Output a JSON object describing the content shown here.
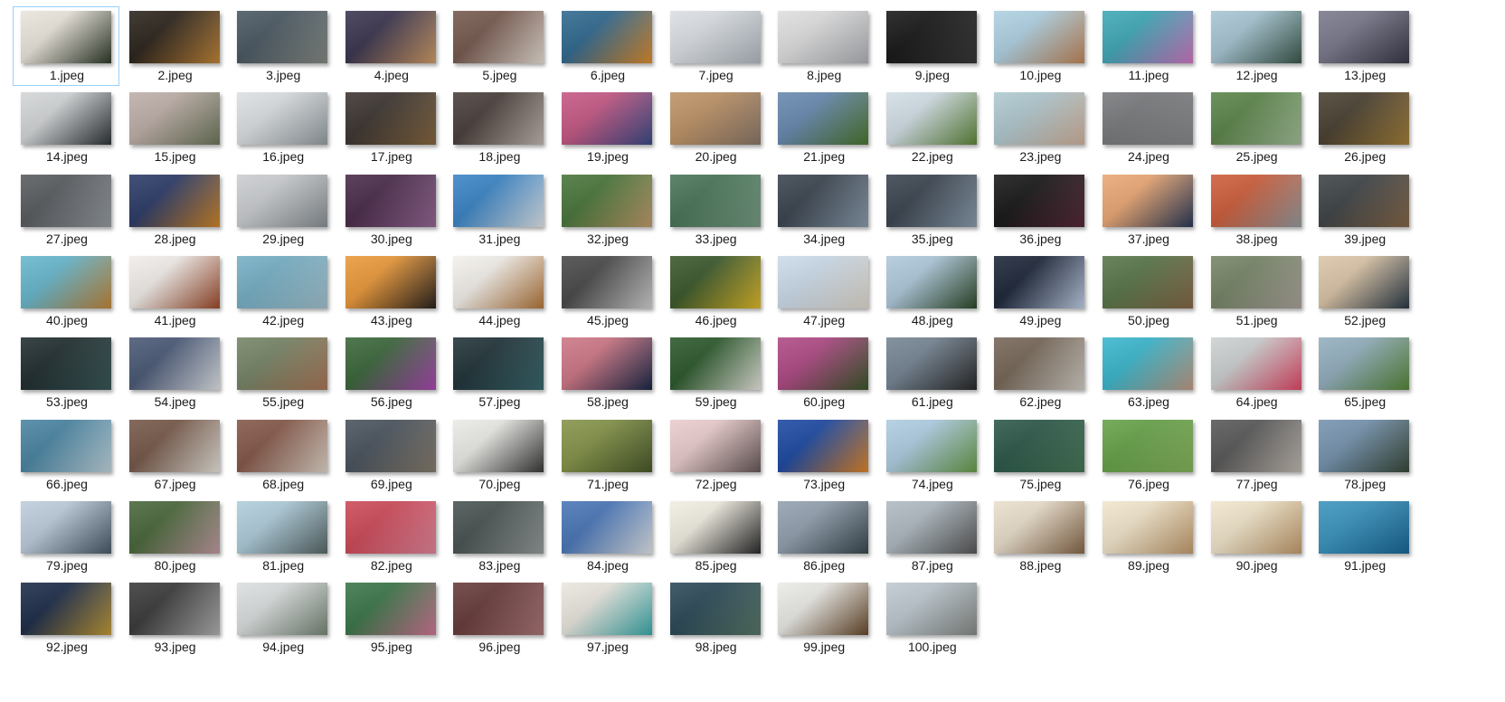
{
  "view": {
    "selected_index": 0,
    "columns": 13
  },
  "files": [
    {
      "name": "1.jpeg",
      "colors": [
        "#e8e2d8",
        "#2f3a2a"
      ]
    },
    {
      "name": "2.jpeg",
      "colors": [
        "#1a120a",
        "#c98a3a"
      ]
    },
    {
      "name": "3.jpeg",
      "colors": [
        "#3b4a55",
        "#8a8f88"
      ]
    },
    {
      "name": "4.jpeg",
      "colors": [
        "#2a2440",
        "#d8a26a"
      ]
    },
    {
      "name": "5.jpeg",
      "colors": [
        "#6a4b40",
        "#efe6dc"
      ]
    },
    {
      "name": "6.jpeg",
      "colors": [
        "#1f5c86",
        "#e8902c"
      ]
    },
    {
      "name": "7.jpeg",
      "colors": [
        "#d8dde2",
        "#b7bec6"
      ]
    },
    {
      "name": "8.jpeg",
      "colors": [
        "#dcdcdc",
        "#b5b8bd"
      ]
    },
    {
      "name": "9.jpeg",
      "colors": [
        "#050505",
        "#3a3a3a"
      ]
    },
    {
      "name": "10.jpeg",
      "colors": [
        "#a8cde0",
        "#c78a5a"
      ]
    },
    {
      "name": "11.jpeg",
      "colors": [
        "#2fa0b0",
        "#d77ac8"
      ]
    },
    {
      "name": "12.jpeg",
      "colors": [
        "#9fc0cf",
        "#3d5a4c"
      ]
    },
    {
      "name": "13.jpeg",
      "colors": [
        "#6e6e82",
        "#3a3a4a"
      ]
    },
    {
      "name": "14.jpeg",
      "colors": [
        "#cfd2d4",
        "#2e3438"
      ]
    },
    {
      "name": "15.jpeg",
      "colors": [
        "#b8a7a0",
        "#6f7a5e"
      ]
    },
    {
      "name": "16.jpeg",
      "colors": [
        "#d9dde0",
        "#9aa3a8"
      ]
    },
    {
      "name": "17.jpeg",
      "colors": [
        "#2c2420",
        "#8a6a42"
      ]
    },
    {
      "name": "18.jpeg",
      "colors": [
        "#3a2e2a",
        "#c9beb8"
      ]
    },
    {
      "name": "19.jpeg",
      "colors": [
        "#c04a7a",
        "#3b4e8a"
      ]
    },
    {
      "name": "20.jpeg",
      "colors": [
        "#b88a5a",
        "#8e7a6c"
      ]
    },
    {
      "name": "21.jpeg",
      "colors": [
        "#5b7fa8",
        "#4e7a2e"
      ]
    },
    {
      "name": "22.jpeg",
      "colors": [
        "#cfdbe4",
        "#5f8a3a"
      ]
    },
    {
      "name": "23.jpeg",
      "colors": [
        "#a9c4cc",
        "#d8b8a0"
      ]
    },
    {
      "name": "24.jpeg",
      "colors": [
        "#6d6f72",
        "#8c8e90"
      ]
    },
    {
      "name": "25.jpeg",
      "colors": [
        "#4e7a3a",
        "#a8c4a0"
      ]
    },
    {
      "name": "26.jpeg",
      "colors": [
        "#3a3020",
        "#a8823a"
      ]
    },
    {
      "name": "27.jpeg",
      "colors": [
        "#4a4e52",
        "#9aa0a6"
      ]
    },
    {
      "name": "28.jpeg",
      "colors": [
        "#1a2a5a",
        "#d88a2a"
      ]
    },
    {
      "name": "29.jpeg",
      "colors": [
        "#c6c9cc",
        "#8d9499"
      ]
    },
    {
      "name": "30.jpeg",
      "colors": [
        "#3a1a3a",
        "#9a6a9a"
      ]
    },
    {
      "name": "31.jpeg",
      "colors": [
        "#2a7ac0",
        "#e8eef2"
      ]
    },
    {
      "name": "32.jpeg",
      "colors": [
        "#3a6a2a",
        "#c8a070"
      ]
    },
    {
      "name": "33.jpeg",
      "colors": [
        "#3a6a4a",
        "#7aa088"
      ]
    },
    {
      "name": "34.jpeg",
      "colors": [
        "#2a3440",
        "#8fa2b4"
      ]
    },
    {
      "name": "35.jpeg",
      "colors": [
        "#2a3440",
        "#8fa2b4"
      ]
    },
    {
      "name": "36.jpeg",
      "colors": [
        "#050505",
        "#5a2a3a"
      ]
    },
    {
      "name": "37.jpeg",
      "colors": [
        "#e8a06a",
        "#2a3a5a"
      ]
    },
    {
      "name": "38.jpeg",
      "colors": [
        "#c8502a",
        "#9aa0a4"
      ]
    },
    {
      "name": "39.jpeg",
      "colors": [
        "#2e3438",
        "#8a6a4a"
      ]
    },
    {
      "name": "40.jpeg",
      "colors": [
        "#5ab0c8",
        "#c88a3a"
      ]
    },
    {
      "name": "41.jpeg",
      "colors": [
        "#f0ece8",
        "#a04a2a"
      ]
    },
    {
      "name": "42.jpeg",
      "colors": [
        "#6aa8c0",
        "#a8c8d4"
      ]
    },
    {
      "name": "43.jpeg",
      "colors": [
        "#e8902a",
        "#2a2420"
      ]
    },
    {
      "name": "44.jpeg",
      "colors": [
        "#f2efea",
        "#b8783a"
      ]
    },
    {
      "name": "45.jpeg",
      "colors": [
        "#3a3a3a",
        "#d8d8d8"
      ]
    },
    {
      "name": "46.jpeg",
      "colors": [
        "#2a4a1a",
        "#e8c02a"
      ]
    },
    {
      "name": "47.jpeg",
      "colors": [
        "#c8d8e8",
        "#e8e0d4"
      ]
    },
    {
      "name": "48.jpeg",
      "colors": [
        "#a8c4d8",
        "#2e4a2a"
      ]
    },
    {
      "name": "49.jpeg",
      "colors": [
        "#0a1428",
        "#c8d8f0"
      ]
    },
    {
      "name": "50.jpeg",
      "colors": [
        "#4a6a3a",
        "#8a6a4a"
      ]
    },
    {
      "name": "51.jpeg",
      "colors": [
        "#6a7a5a",
        "#b0a8a0"
      ]
    },
    {
      "name": "52.jpeg",
      "colors": [
        "#d8c0a0",
        "#2a3a48"
      ]
    },
    {
      "name": "53.jpeg",
      "colors": [
        "#0e1c1e",
        "#3a5a5a"
      ]
    },
    {
      "name": "54.jpeg",
      "colors": [
        "#3a4a6a",
        "#e8ecf0"
      ]
    },
    {
      "name": "55.jpeg",
      "colors": [
        "#6a7a5a",
        "#b07a5a"
      ]
    },
    {
      "name": "56.jpeg",
      "colors": [
        "#2a5a2a",
        "#b04ab8"
      ]
    },
    {
      "name": "57.jpeg",
      "colors": [
        "#0e2228",
        "#3a6a70"
      ]
    },
    {
      "name": "58.jpeg",
      "colors": [
        "#c86a7a",
        "#1a2a4a"
      ]
    },
    {
      "name": "59.jpeg",
      "colors": [
        "#1a4a1a",
        "#f0f0e8"
      ]
    },
    {
      "name": "60.jpeg",
      "colors": [
        "#a83a7a",
        "#3a5a2a"
      ]
    },
    {
      "name": "61.jpeg",
      "colors": [
        "#6a7a8a",
        "#2a2a2a"
      ]
    },
    {
      "name": "62.jpeg",
      "colors": [
        "#6a5a4a",
        "#d8d4cc"
      ]
    },
    {
      "name": "63.jpeg",
      "colors": [
        "#2ab0c8",
        "#c8a088"
      ]
    },
    {
      "name": "64.jpeg",
      "colors": [
        "#c8cccc",
        "#e84a6a"
      ]
    },
    {
      "name": "65.jpeg",
      "colors": [
        "#8aa8b8",
        "#5a8a3a"
      ]
    },
    {
      "name": "66.jpeg",
      "colors": [
        "#3a7a9a",
        "#c8dce4"
      ]
    },
    {
      "name": "67.jpeg",
      "colors": [
        "#6a4a3a",
        "#f0ece4"
      ]
    },
    {
      "name": "68.jpeg",
      "colors": [
        "#7a4a3a",
        "#e8dcd0"
      ]
    },
    {
      "name": "69.jpeg",
      "colors": [
        "#3a4450",
        "#8a8070"
      ]
    },
    {
      "name": "70.jpeg",
      "colors": [
        "#e8e8e4",
        "#3a3a3a"
      ]
    },
    {
      "name": "71.jpeg",
      "colors": [
        "#7a8a3a",
        "#4a5a2a"
      ]
    },
    {
      "name": "72.jpeg",
      "colors": [
        "#e8c8c8",
        "#6a5a5a"
      ]
    },
    {
      "name": "73.jpeg",
      "colors": [
        "#0a3a9a",
        "#e88a2a"
      ]
    },
    {
      "name": "74.jpeg",
      "colors": [
        "#a8c8e0",
        "#6aa04a"
      ]
    },
    {
      "name": "75.jpeg",
      "colors": [
        "#1a4a3a",
        "#4a7a5a"
      ]
    },
    {
      "name": "76.jpeg",
      "colors": [
        "#5a9a3a",
        "#8ab860"
      ]
    },
    {
      "name": "77.jpeg",
      "colors": [
        "#4a4a4a",
        "#c8c0b8"
      ]
    },
    {
      "name": "78.jpeg",
      "colors": [
        "#6a8aa8",
        "#3a4a3a"
      ]
    },
    {
      "name": "79.jpeg",
      "colors": [
        "#b8c8d8",
        "#4a5a6a"
      ]
    },
    {
      "name": "80.jpeg",
      "colors": [
        "#3a5a2a",
        "#c8a0a8"
      ]
    },
    {
      "name": "81.jpeg",
      "colors": [
        "#a8c8d8",
        "#5a6a6a"
      ]
    },
    {
      "name": "82.jpeg",
      "colors": [
        "#c83a4a",
        "#e88aa0"
      ]
    },
    {
      "name": "83.jpeg",
      "colors": [
        "#3a4444",
        "#9aa0a0"
      ]
    },
    {
      "name": "84.jpeg",
      "colors": [
        "#3a6ab0",
        "#e8ecf0"
      ]
    },
    {
      "name": "85.jpeg",
      "colors": [
        "#f0ece0",
        "#2a2a2a"
      ]
    },
    {
      "name": "86.jpeg",
      "colors": [
        "#8a98a8",
        "#3a4a50"
      ]
    },
    {
      "name": "87.jpeg",
      "colors": [
        "#a8b4bc",
        "#5a5a5a"
      ]
    },
    {
      "name": "88.jpeg",
      "colors": [
        "#e8dcc8",
        "#8a6a4a"
      ]
    },
    {
      "name": "89.jpeg",
      "colors": [
        "#f0e4c8",
        "#c8a070"
      ]
    },
    {
      "name": "90.jpeg",
      "colors": [
        "#f0e4c8",
        "#c8a070"
      ]
    },
    {
      "name": "91.jpeg",
      "colors": [
        "#2a8ab8",
        "#1a6a9a"
      ]
    },
    {
      "name": "92.jpeg",
      "colors": [
        "#0a1a3a",
        "#c8a03a"
      ]
    },
    {
      "name": "93.jpeg",
      "colors": [
        "#2a2a2a",
        "#b8b8b8"
      ]
    },
    {
      "name": "94.jpeg",
      "colors": [
        "#d8dcdc",
        "#7a8a7a"
      ]
    },
    {
      "name": "95.jpeg",
      "colors": [
        "#2a6a3a",
        "#d87a9a"
      ]
    },
    {
      "name": "96.jpeg",
      "colors": [
        "#5a2a2a",
        "#b07a7a"
      ]
    },
    {
      "name": "97.jpeg",
      "colors": [
        "#e8e4dc",
        "#3ab0b0"
      ]
    },
    {
      "name": "98.jpeg",
      "colors": [
        "#1a3a4a",
        "#5a7a6a"
      ]
    },
    {
      "name": "99.jpeg",
      "colors": [
        "#e8e8e4",
        "#6a4a2a"
      ]
    },
    {
      "name": "100.jpeg",
      "colors": [
        "#b8c4cc",
        "#8a8e8a"
      ]
    }
  ]
}
